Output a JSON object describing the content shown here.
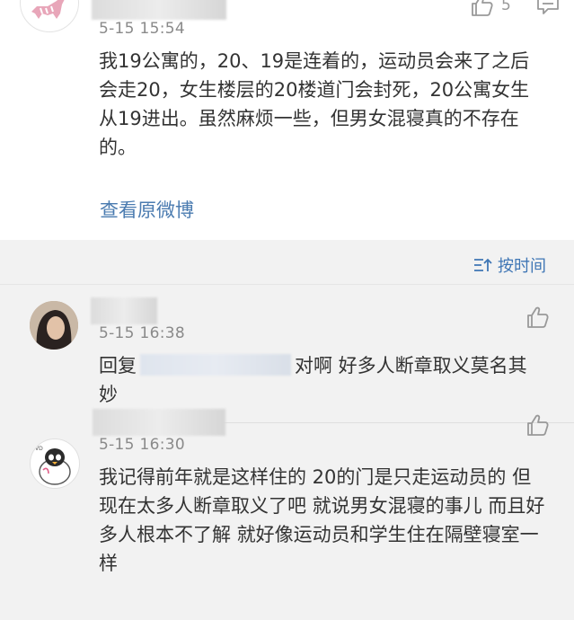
{
  "post": {
    "time": "5-15 15:54",
    "like_count": "5",
    "text": "我19公寓的，20、19是连着的，运动员会来了之后会走20，女生楼层的20楼道门会封死，20公寓女生从19进出。虽然麻烦一些，但男女混寝真的不存在的。",
    "view_original_label": "查看原微博"
  },
  "sort": {
    "label": "按时间"
  },
  "comments": [
    {
      "time": "5-15 16:38",
      "reply_prefix": "回复",
      "text": "对啊  好多人断章取义莫名其妙"
    },
    {
      "time": "5-15 16:30",
      "text": "我记得前年就是这样住的 20的门是只走运动员的 但现在太多人断章取义了吧 就说男女混寝的事儿 而且好多人根本不了解 就好像运动员和学生住在隔壁寝室一样"
    }
  ],
  "colors": {
    "link": "#4a7bb0",
    "sort": "#3f76b5",
    "reply_bg": "#f2f2f2"
  },
  "icons": [
    "zebra-avatar",
    "like-icon",
    "comment-icon",
    "sort-icon",
    "girl-avatar",
    "penguin-avatar"
  ]
}
